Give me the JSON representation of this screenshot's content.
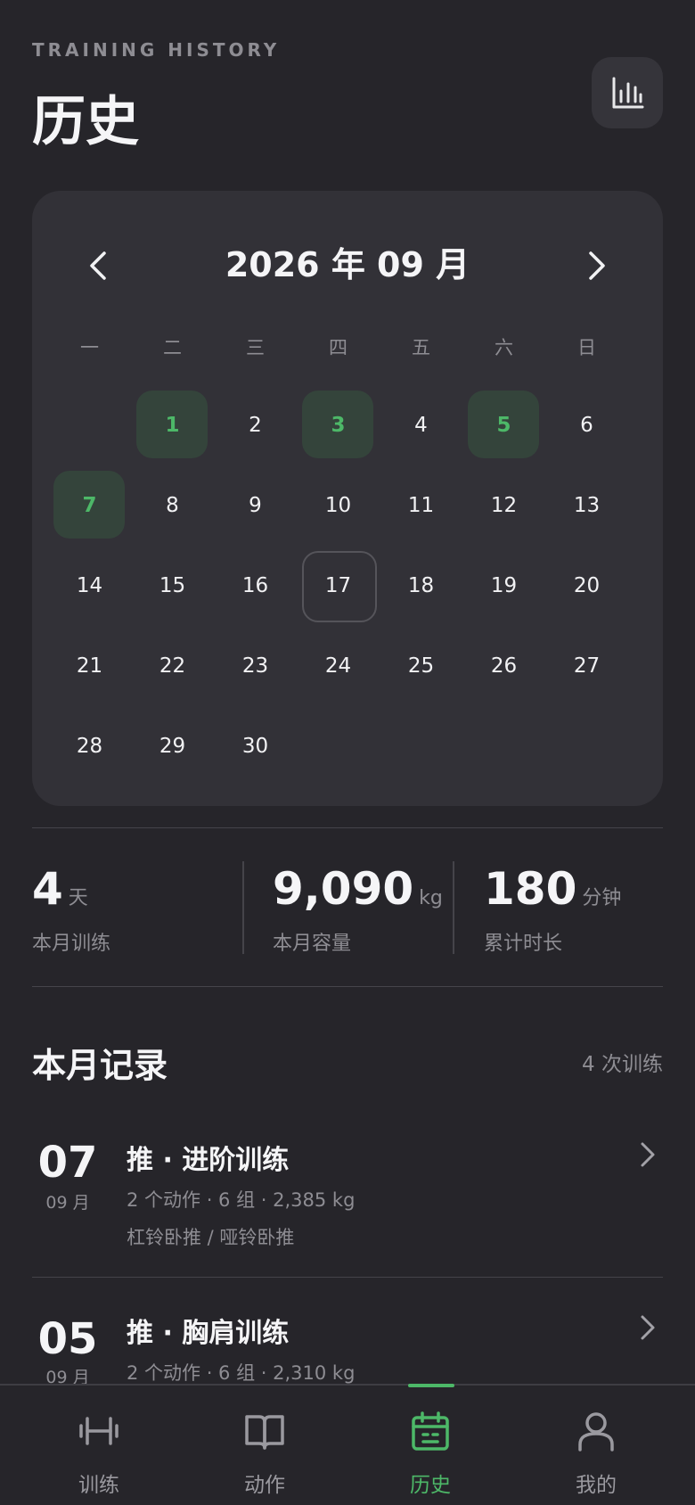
{
  "header": {
    "eyebrow": "TRAINING HISTORY",
    "title": "历史",
    "stats_icon": "bar-chart-icon"
  },
  "calendar": {
    "title": "2026 年 09 月",
    "prev_icon": "chevron-left-icon",
    "next_icon": "chevron-right-icon",
    "weekdays": [
      "一",
      "二",
      "三",
      "四",
      "五",
      "六",
      "日"
    ],
    "days": [
      {
        "n": "",
        "state": "empty"
      },
      {
        "n": "1",
        "state": "trained"
      },
      {
        "n": "2",
        "state": ""
      },
      {
        "n": "3",
        "state": "trained"
      },
      {
        "n": "4",
        "state": ""
      },
      {
        "n": "5",
        "state": "trained"
      },
      {
        "n": "6",
        "state": ""
      },
      {
        "n": "7",
        "state": "trained"
      },
      {
        "n": "8",
        "state": ""
      },
      {
        "n": "9",
        "state": ""
      },
      {
        "n": "10",
        "state": ""
      },
      {
        "n": "11",
        "state": ""
      },
      {
        "n": "12",
        "state": ""
      },
      {
        "n": "13",
        "state": ""
      },
      {
        "n": "14",
        "state": ""
      },
      {
        "n": "15",
        "state": ""
      },
      {
        "n": "16",
        "state": ""
      },
      {
        "n": "17",
        "state": "today"
      },
      {
        "n": "18",
        "state": ""
      },
      {
        "n": "19",
        "state": ""
      },
      {
        "n": "20",
        "state": ""
      },
      {
        "n": "21",
        "state": ""
      },
      {
        "n": "22",
        "state": ""
      },
      {
        "n": "23",
        "state": ""
      },
      {
        "n": "24",
        "state": ""
      },
      {
        "n": "25",
        "state": ""
      },
      {
        "n": "26",
        "state": ""
      },
      {
        "n": "27",
        "state": ""
      },
      {
        "n": "28",
        "state": ""
      },
      {
        "n": "29",
        "state": ""
      },
      {
        "n": "30",
        "state": ""
      }
    ]
  },
  "stats": [
    {
      "value": "4",
      "unit": "天",
      "label": "本月训练"
    },
    {
      "value": "9,090",
      "unit": "kg",
      "label": "本月容量"
    },
    {
      "value": "180",
      "unit": "分钟",
      "label": "累计时长"
    }
  ],
  "records_section": {
    "title": "本月记录",
    "count": "4 次训练"
  },
  "records": [
    {
      "day": "07",
      "month": "09 月",
      "title": "推 · 进阶训练",
      "meta": "2 个动作 · 6 组 · 2,385 kg",
      "exercises": "杠铃卧推 / 哑铃卧推"
    },
    {
      "day": "05",
      "month": "09 月",
      "title": "推 · 胸肩训练",
      "meta": "2 个动作 · 6 组 · 2,310 kg",
      "exercises": ""
    }
  ],
  "tabs": [
    {
      "label": "训练",
      "icon": "dumbbell-icon",
      "active": false
    },
    {
      "label": "动作",
      "icon": "book-icon",
      "active": false
    },
    {
      "label": "历史",
      "icon": "calendar-icon",
      "active": true
    },
    {
      "label": "我的",
      "icon": "person-icon",
      "active": false
    }
  ],
  "colors": {
    "background": "#26252a",
    "card": "#323137",
    "accent": "#4db868",
    "trained_bg": "#34443b",
    "muted_text": "#8e8d93"
  }
}
